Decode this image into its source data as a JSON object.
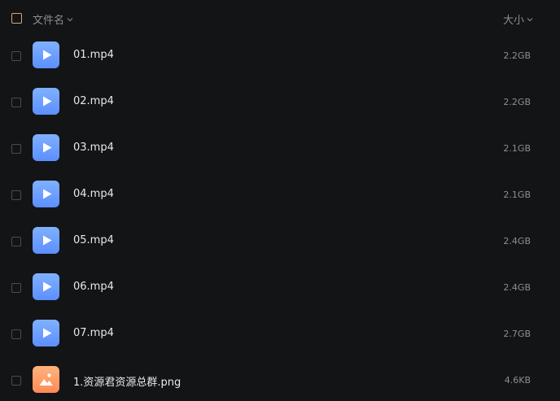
{
  "header": {
    "name_label": "文件名",
    "size_label": "大小"
  },
  "files": [
    {
      "name": "01.mp4",
      "size": "2.2GB",
      "type": "video",
      "icon": "video-file-icon"
    },
    {
      "name": "02.mp4",
      "size": "2.2GB",
      "type": "video",
      "icon": "video-file-icon"
    },
    {
      "name": "03.mp4",
      "size": "2.1GB",
      "type": "video",
      "icon": "video-file-icon"
    },
    {
      "name": "04.mp4",
      "size": "2.1GB",
      "type": "video",
      "icon": "video-file-icon"
    },
    {
      "name": "05.mp4",
      "size": "2.4GB",
      "type": "video",
      "icon": "video-file-icon"
    },
    {
      "name": "06.mp4",
      "size": "2.4GB",
      "type": "video",
      "icon": "video-file-icon"
    },
    {
      "name": "07.mp4",
      "size": "2.7GB",
      "type": "video",
      "icon": "video-file-icon"
    },
    {
      "name": "1.资源君资源总群.png",
      "size": "4.6KB",
      "type": "image",
      "icon": "image-file-icon"
    }
  ],
  "colors": {
    "background": "#131416",
    "video_icon": "#6b9dff",
    "image_icon": "#ff9a62",
    "header_checkbox": "#d7a86e"
  }
}
